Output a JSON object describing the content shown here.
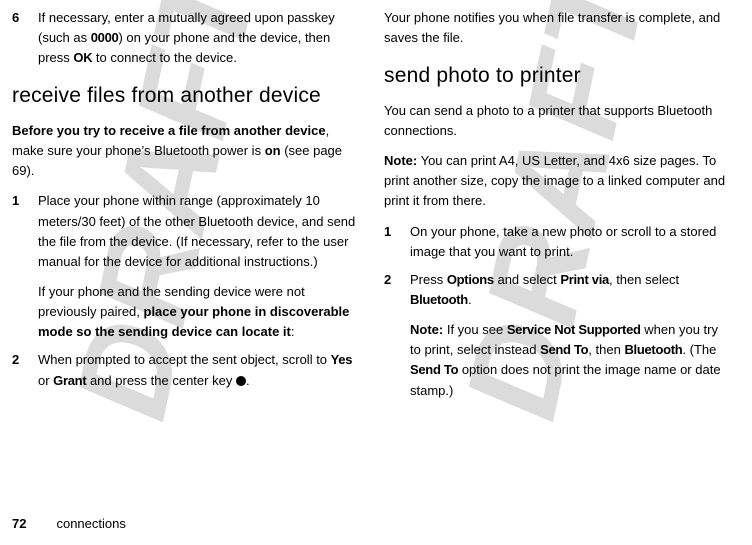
{
  "watermark": "DRAFT",
  "left": {
    "step6": {
      "num": "6",
      "a": "If necessary, enter a mutually agreed upon passkey (such as ",
      "code1": "0000",
      "b": ") on your phone and the device, then press ",
      "code2": "OK",
      "c": " to connect to the device."
    },
    "h_receive": "receive files from another device",
    "intro": {
      "a": "Before you try to receive a file from another device",
      "b": ", make sure your phone’s Bluetooth power is ",
      "on": "on",
      "c": " (see page 69)."
    },
    "step1": {
      "num": "1",
      "text": "Place your phone within range (approximately 10 meters/30 feet) of the other Bluetooth device, and send the file from the device. (If necessary, refer to the user manual for the device for additional instructions.)",
      "sub_a": "If your phone and the sending device were not previously paired, ",
      "sub_b": "place your phone in discoverable mode so the sending device can locate it",
      "sub_c": ":"
    },
    "step2": {
      "num": "2",
      "a": "When prompted to accept the sent object, scroll to ",
      "yes": "Yes",
      "or": " or ",
      "grant": "Grant",
      "b": " and press the center key ",
      "c": "."
    }
  },
  "right": {
    "top": "Your phone notifies you when file transfer is complete, and saves the file.",
    "h_send": "send photo to printer",
    "p1": "You can send a photo to a printer that supports Bluetooth connections.",
    "note_label": "Note:",
    "note_text": " You can print A4, US Letter, and 4x6 size pages. To print another size, copy the image to a linked computer and print it from there.",
    "step1": {
      "num": "1",
      "text": "On your phone, take a new photo or scroll to a stored image that you want to print."
    },
    "step2": {
      "num": "2",
      "a": "Press ",
      "opt": "Options",
      "b": " and select ",
      "pv": "Print via",
      "c": ", then select ",
      "bt": "Bluetooth",
      "d": ".",
      "note_label": "Note:",
      "note_a": " If you see ",
      "sns": "Service Not Supported",
      "note_b": " when you try to print, select instead ",
      "sendto1": "Send To",
      "note_c": ", then ",
      "bt2": "Bluetooth",
      "note_d": ". (The ",
      "sendto2": "Send To",
      "note_e": " option does not print the image name or date stamp.)"
    }
  },
  "footer": {
    "page": "72",
    "section": "connections"
  }
}
